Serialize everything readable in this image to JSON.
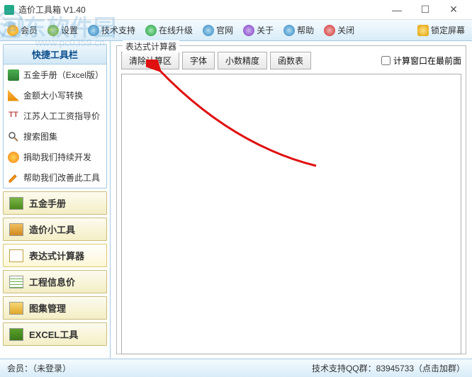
{
  "window": {
    "title": "造价工具箱 V1.40"
  },
  "toolbar": {
    "member": "会员",
    "settings": "设置",
    "techSupport": "技术支持",
    "onlineUpgrade": "在线升级",
    "website": "官网",
    "about": "关于",
    "help": "帮助",
    "close": "关闭",
    "lockScreen": "锁定屏幕"
  },
  "sidebar": {
    "header": "快捷工具栏",
    "items": [
      "五金手册（Excel版）",
      "金额大小写转换",
      "江苏人工工资指导价",
      "搜索图集",
      "捐助我们持续开发",
      "帮助我们改善此工具"
    ],
    "nav": [
      "五金手册",
      "造价小工具",
      "表达式计算器",
      "工程信息价",
      "图集管理",
      "EXCEL工具"
    ],
    "activeNav": 2
  },
  "calc": {
    "groupTitle": "表达式计算器",
    "buttons": {
      "clear": "清除计算区",
      "font": "字体",
      "precision": "小数精度",
      "funcTable": "函数表"
    },
    "checkbox": "计算窗口在最前面"
  },
  "status": {
    "left": "会员：（未登录）",
    "right": "技术支持QQ群：83945733（点击加群）"
  },
  "watermark": {
    "main": "河东软件园",
    "sub": "www.pc0359.cn"
  }
}
